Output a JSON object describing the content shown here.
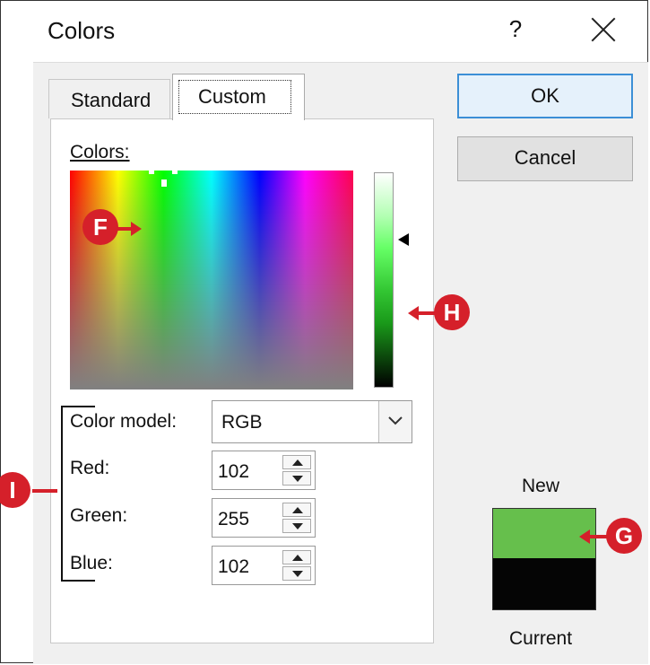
{
  "dialog": {
    "title": "Colors",
    "help_label": "?"
  },
  "tabs": [
    {
      "label": "Standard"
    },
    {
      "label": "Custom"
    }
  ],
  "custom": {
    "colors_label": "Colors:",
    "color_model": {
      "label": "Color model:",
      "value": "RGB"
    },
    "red": {
      "label": "Red:",
      "value": "102"
    },
    "green": {
      "label": "Green:",
      "value": "255"
    },
    "blue": {
      "label": "Blue:",
      "value": "102"
    }
  },
  "buttons": {
    "ok": "OK",
    "cancel": "Cancel"
  },
  "preview": {
    "new_label": "New",
    "current_label": "Current",
    "new_color": "#66bf4c",
    "current_color": "#050505"
  },
  "callouts": {
    "f": "F",
    "g": "G",
    "h": "H",
    "i": "I"
  },
  "colors": {
    "accent": "#d5202a",
    "ok_border": "#3c8fd6"
  }
}
